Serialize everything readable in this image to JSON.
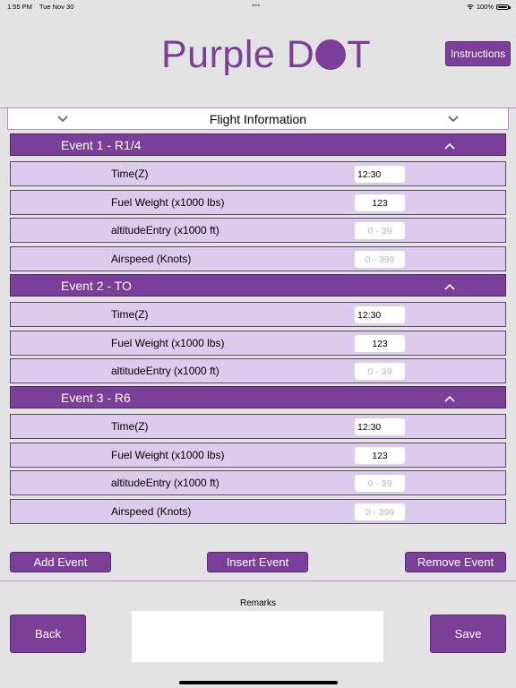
{
  "status": {
    "time": "1:55 PM",
    "date": "Tue Nov 30",
    "battery": "100%",
    "dots": "•••"
  },
  "header": {
    "logo_text_1": "Purple D",
    "logo_text_2": "T",
    "instructions_label": "Instructions"
  },
  "section": {
    "title": "Flight Information"
  },
  "events": [
    {
      "title": "Event 1 - R1/4",
      "rows": [
        {
          "label": "Time(Z)",
          "value": "12:30",
          "placeholder": ""
        },
        {
          "label": "Fuel Weight (x1000 lbs)",
          "value": "123",
          "placeholder": ""
        },
        {
          "label": "altitudeEntry (x1000 ft)",
          "value": "",
          "placeholder": "0 - 39"
        },
        {
          "label": "Airspeed (Knots)",
          "value": "",
          "placeholder": "0 - 399"
        }
      ]
    },
    {
      "title": "Event 2 - TO",
      "rows": [
        {
          "label": "Time(Z)",
          "value": "12:30",
          "placeholder": ""
        },
        {
          "label": "Fuel Weight (x1000 lbs)",
          "value": "123",
          "placeholder": ""
        },
        {
          "label": "altitudeEntry (x1000 ft)",
          "value": "",
          "placeholder": "0 - 39"
        }
      ]
    },
    {
      "title": "Event 3 - R6",
      "rows": [
        {
          "label": "Time(Z)",
          "value": "12:30",
          "placeholder": ""
        },
        {
          "label": "Fuel Weight (x1000 lbs)",
          "value": "123",
          "placeholder": ""
        },
        {
          "label": "altitudeEntry (x1000 ft)",
          "value": "",
          "placeholder": "0 - 39"
        },
        {
          "label": "Airspeed (Knots)",
          "value": "",
          "placeholder": "0 - 399"
        }
      ]
    }
  ],
  "actions": {
    "add_event": "Add Event",
    "insert_event": "Insert Event",
    "remove_event": "Remove Event"
  },
  "footer": {
    "remarks_label": "Remarks",
    "remarks_value": "",
    "back_label": "Back",
    "save_label": "Save"
  },
  "colors": {
    "accent": "#7b3f9a",
    "row_bg": "#dccbec",
    "background": "#e3e3e3"
  }
}
